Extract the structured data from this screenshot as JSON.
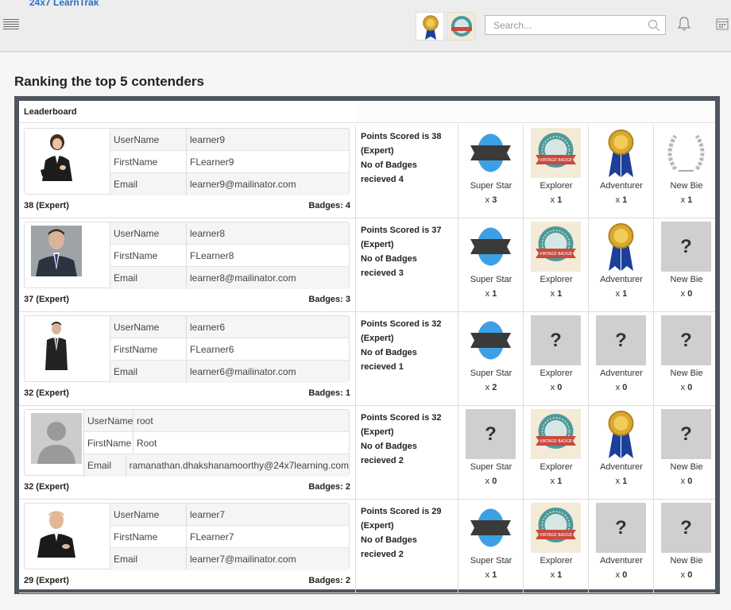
{
  "app": {
    "brand": "24x7 LearnTrak",
    "brand_mark": "™"
  },
  "header": {
    "search_placeholder": "Search..."
  },
  "page_title": "Ranking the top 5 contenders",
  "leaderboard_label": "Leaderboard",
  "labels": {
    "username": "UserName",
    "firstname": "FirstName",
    "email": "Email"
  },
  "colors": {
    "panel_border": "#505660",
    "brand": "#2a6fc4"
  },
  "badge_names": [
    "Super Star",
    "Explorer",
    "Adventurer",
    "New Bie"
  ],
  "rows": [
    {
      "username": "learner9",
      "firstname": "FLearner9",
      "email": "learner9@mailinator.com",
      "score": "38 (Expert)",
      "badges": "Badges: 4",
      "points_text": "Points Scored is 38 (Expert)",
      "badges_text": "No of Badges recieved 4",
      "counts": [
        "x 3",
        "x 1",
        "x 1",
        "x 1"
      ]
    },
    {
      "username": "learner8",
      "firstname": "FLearner8",
      "email": "learner8@mailinator.com",
      "score": "37 (Expert)",
      "badges": "Badges: 3",
      "points_text": "Points Scored is 37 (Expert)",
      "badges_text": "No of Badges recieved 3",
      "counts": [
        "x 1",
        "x 1",
        "x 1",
        "x 0"
      ]
    },
    {
      "username": "learner6",
      "firstname": "FLearner6",
      "email": "learner6@mailinator.com",
      "score": "32 (Expert)",
      "badges": "Badges: 1",
      "points_text": "Points Scored is 32 (Expert)",
      "badges_text": "No of Badges recieved 1",
      "counts": [
        "x 2",
        "x 0",
        "x 0",
        "x 0"
      ]
    },
    {
      "username": "root",
      "firstname": "Root",
      "email": "ramanathan.dhakshanamoorthy@24x7learning.com",
      "score": "32 (Expert)",
      "badges": "Badges: 2",
      "points_text": "Points Scored is 32 (Expert)",
      "badges_text": "No of Badges recieved 2",
      "counts": [
        "x 0",
        "x 1",
        "x 1",
        "x 0"
      ]
    },
    {
      "username": "learner7",
      "firstname": "FLearner7",
      "email": "learner7@mailinator.com",
      "score": "29 (Expert)",
      "badges": "Badges: 2",
      "points_text": "Points Scored is 29 (Expert)",
      "badges_text": "No of Badges recieved 2",
      "counts": [
        "x 1",
        "x 1",
        "x 0",
        "x 0"
      ]
    }
  ],
  "unknown_badge_glyph": "?"
}
